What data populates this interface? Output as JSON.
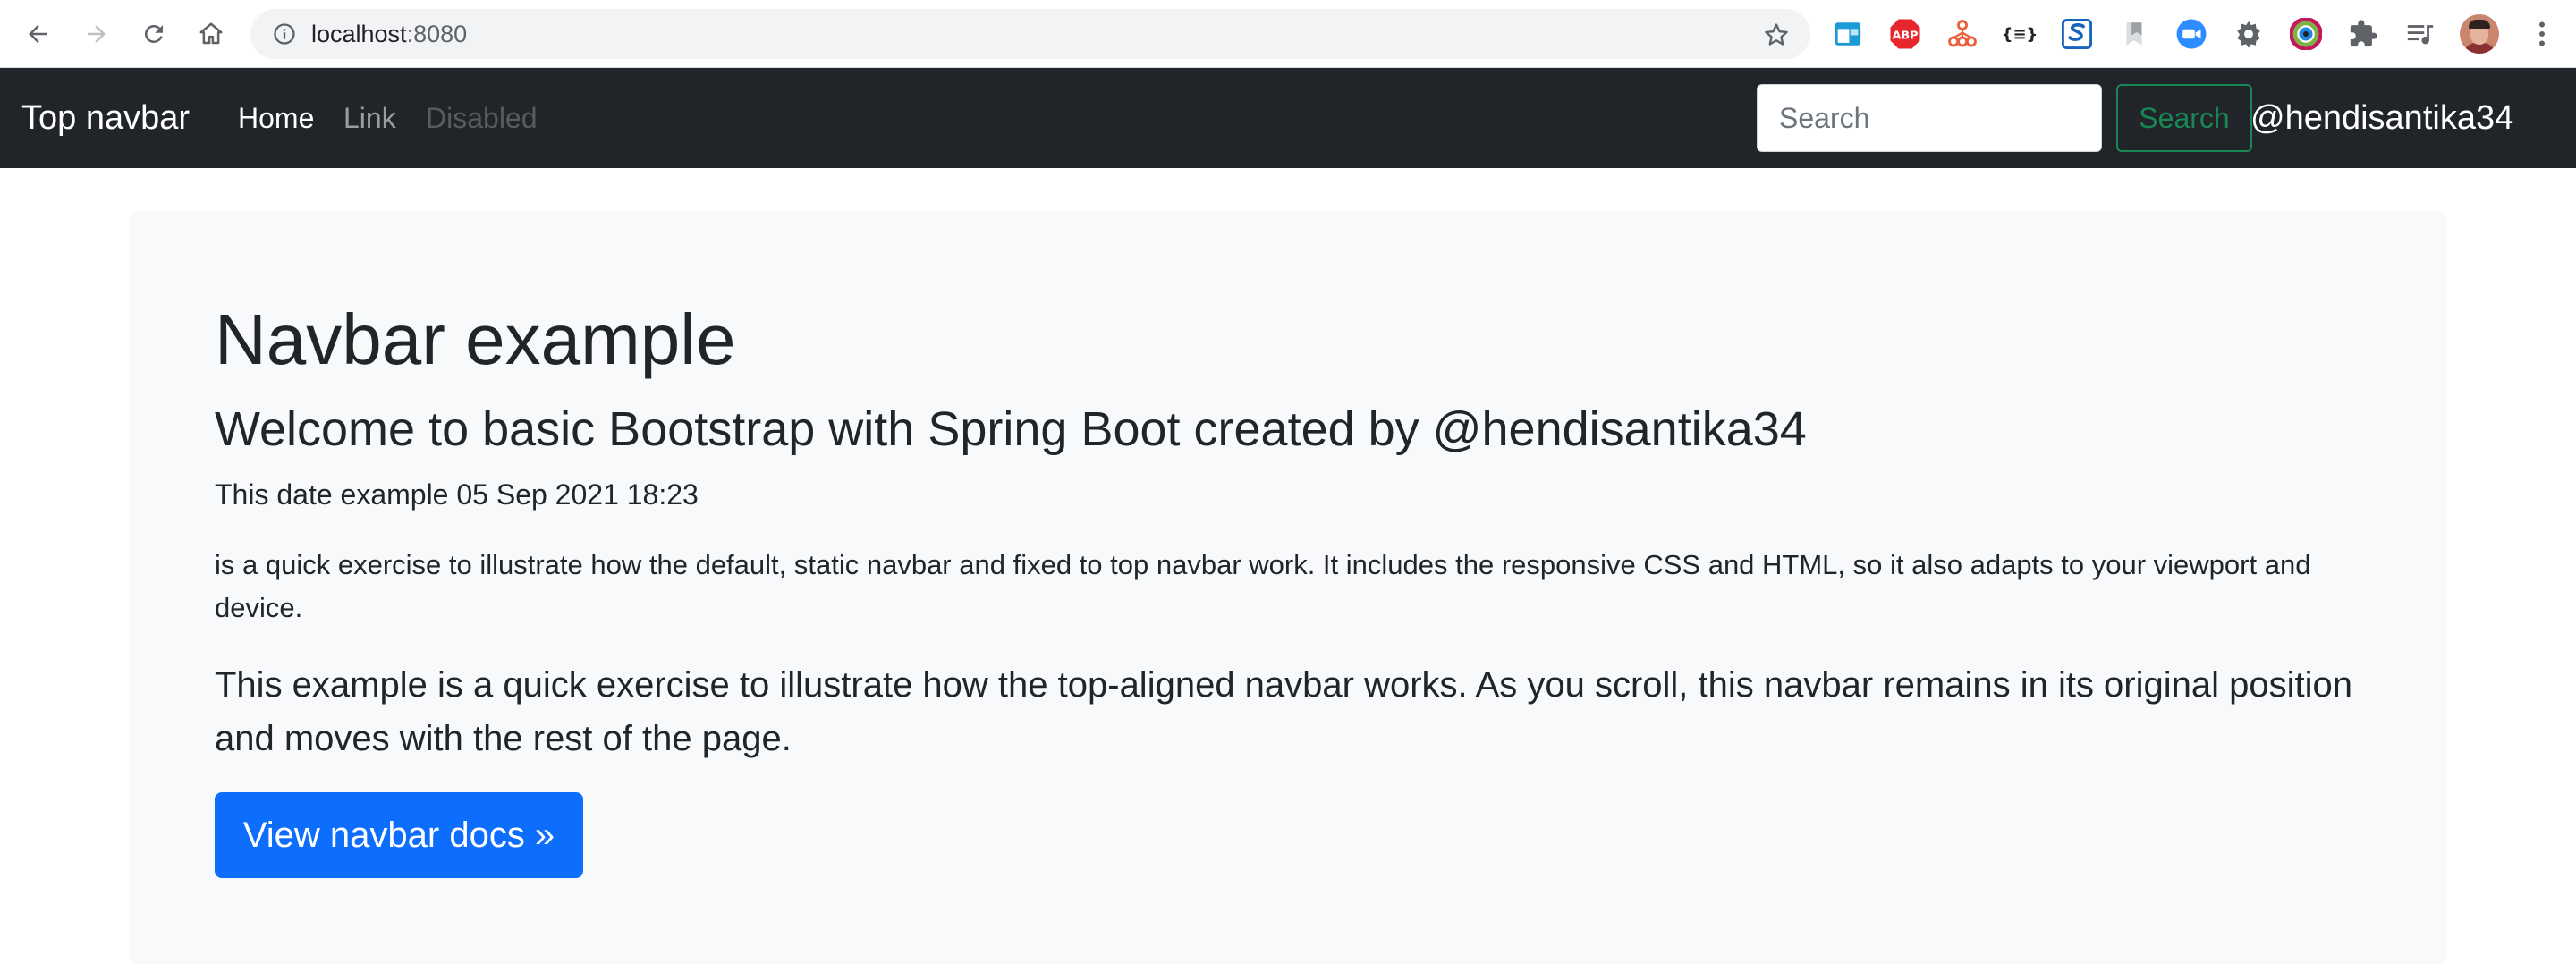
{
  "browser": {
    "url_host": "localhost",
    "url_port": ":8080",
    "icons": {
      "back": "back-arrow-icon",
      "forward": "forward-arrow-icon",
      "reload": "reload-icon",
      "home": "home-icon",
      "info": "site-info-icon",
      "bookmark": "star-icon"
    },
    "extensions": [
      {
        "name": "window-resizer-icon",
        "color": "#1a9bd7"
      },
      {
        "name": "adblock-plus-icon",
        "label": "ABP",
        "color": "#e8262d"
      },
      {
        "name": "network-tree-icon",
        "color": "#e8613a"
      },
      {
        "name": "json-formatter-icon",
        "label": "{≡}",
        "color": "#202124"
      },
      {
        "name": "s-extension-icon",
        "label": "S",
        "color": "#1565c0"
      },
      {
        "name": "bookmark-extension-icon",
        "color": "#9aa0a6"
      },
      {
        "name": "zoom-video-icon",
        "color": "#2d8cff"
      },
      {
        "name": "gear-extension-icon",
        "color": "#5f6368"
      },
      {
        "name": "color-picker-icon",
        "color": "#c2185b"
      },
      {
        "name": "puzzle-extensions-icon",
        "color": "#5f6368"
      },
      {
        "name": "media-queue-icon",
        "color": "#5f6368"
      }
    ]
  },
  "navbar": {
    "brand": "Top navbar",
    "links": [
      {
        "label": "Home",
        "state": "active"
      },
      {
        "label": "Link",
        "state": "normal"
      },
      {
        "label": "Disabled",
        "state": "disabled"
      }
    ],
    "search_placeholder": "Search",
    "search_button": "Search",
    "user_handle": "@hendisantika34",
    "colors": {
      "background": "#212529",
      "search_button": "#198754"
    }
  },
  "main": {
    "title": "Navbar example",
    "subtitle": "Welcome to basic Bootstrap with Spring Boot created by @hendisantika34",
    "date_line": "This date example 05 Sep 2021 18:23",
    "paragraph": "is a quick exercise to illustrate how the default, static navbar and fixed to top navbar work. It includes the responsive CSS and HTML, so it also adapts to your viewport and device.",
    "lead": "This example is a quick exercise to illustrate how the top-aligned navbar works. As you scroll, this navbar remains in its original position and moves with the rest of the page.",
    "docs_button": "View navbar docs »",
    "colors": {
      "panel": "#f8f9fa",
      "primary": "#0d6efd"
    }
  }
}
